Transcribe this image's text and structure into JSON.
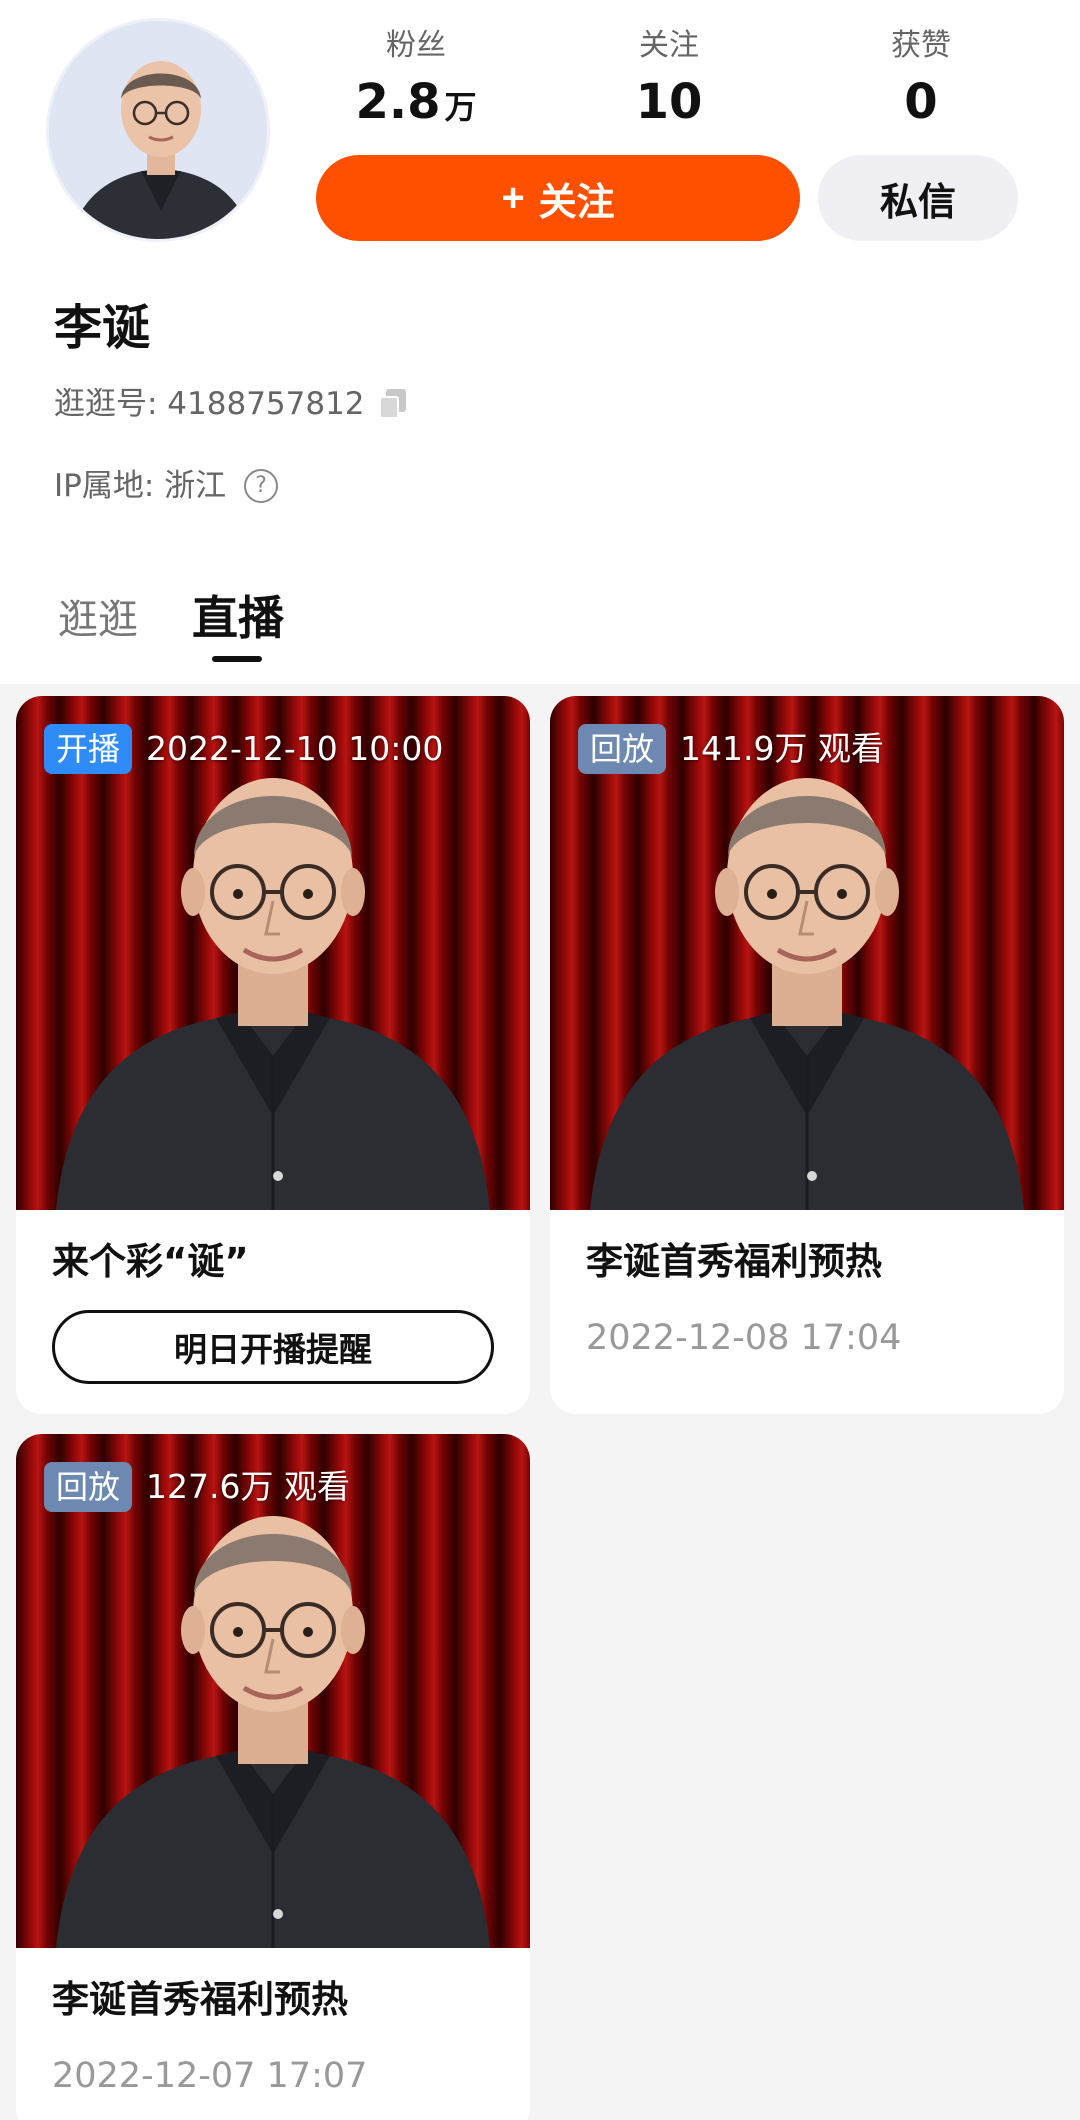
{
  "profile": {
    "name": "李诞",
    "id_label": "逛逛号: 4188757812",
    "ip_label": "IP属地: 浙江",
    "help_glyph": "?"
  },
  "stats": {
    "fans_label": "粉丝",
    "fans_value": "2.8",
    "fans_unit": "万",
    "following_label": "关注",
    "following_value": "10",
    "likes_label": "获赞",
    "likes_value": "0"
  },
  "actions": {
    "follow_plus": "+",
    "follow_label": "关注",
    "message_label": "私信"
  },
  "tabs": [
    {
      "label": "逛逛",
      "active": false
    },
    {
      "label": "直播",
      "active": true
    }
  ],
  "cards": [
    {
      "badge": "开播",
      "badge_text": "2022-12-10 10:00",
      "title": "来个彩“诞”",
      "button": "明日开播提醒"
    },
    {
      "badge": "回放",
      "badge_text": "141.9万 观看",
      "title": "李诞首秀福利预热",
      "date": "2022-12-08 17:04"
    },
    {
      "badge": "回放",
      "badge_text": "127.6万 观看",
      "title": "李诞首秀福利预热",
      "date": "2022-12-07 17:07"
    }
  ],
  "colors": {
    "accent": "#ff5000",
    "live_badge": "#2f8cf7",
    "replay_badge": "#6d89b2",
    "feed_bg": "#f4f4f4"
  }
}
